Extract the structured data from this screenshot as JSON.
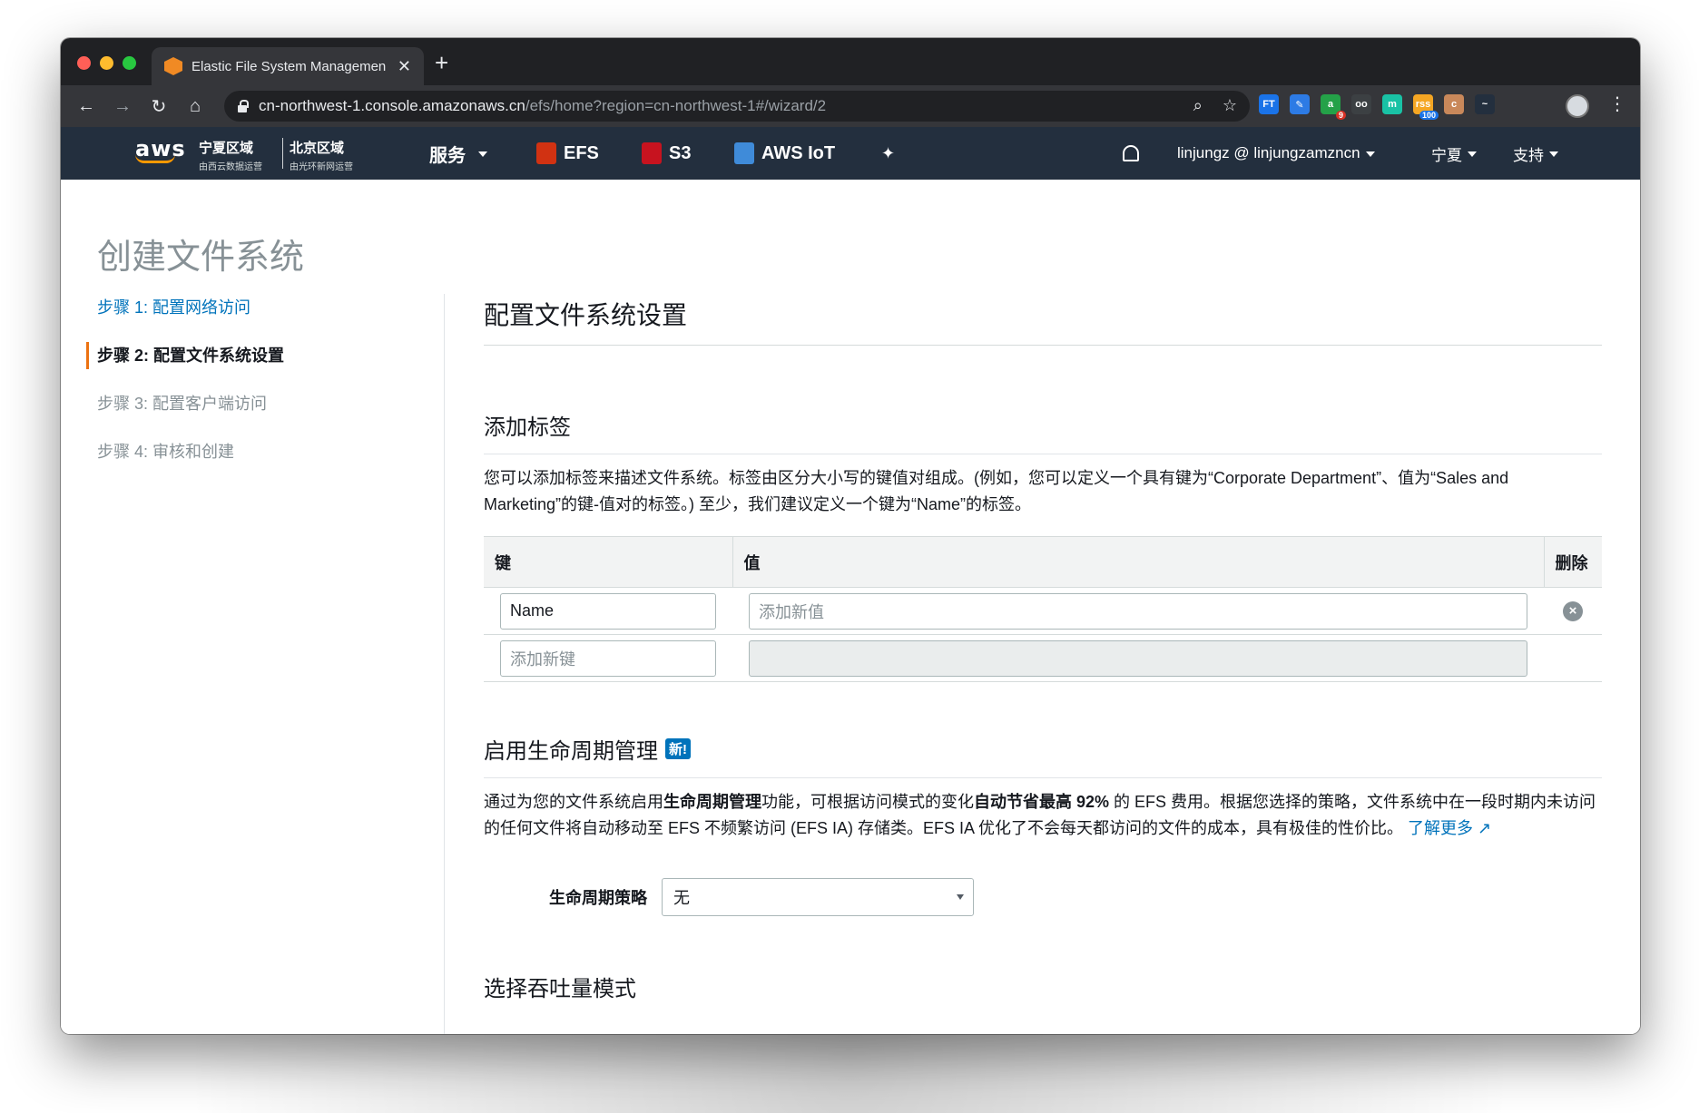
{
  "browser": {
    "tab_title": "Elastic File System Managemen",
    "new_tab": "+",
    "close_tab": "✕",
    "url_host": "cn-northwest-1.console.amazonaws.cn",
    "url_path": "/efs/home?region=cn-northwest-1#/wizard/2",
    "extensions": [
      {
        "name": "FT",
        "color": "#1a73e8"
      },
      {
        "name": "✎",
        "color": "#2d7be5"
      },
      {
        "name": "a",
        "color": "#24a148",
        "badge": "9"
      },
      {
        "name": "oo",
        "color": "#3c4043"
      },
      {
        "name": "m",
        "color": "#19c2a5"
      },
      {
        "name": "rss",
        "color": "#f5a623",
        "badge": "100"
      },
      {
        "name": "c",
        "color": "#c9885a"
      },
      {
        "name": "~",
        "color": "#232f3e"
      }
    ]
  },
  "aws": {
    "logo": "aws",
    "region1": {
      "name": "宁夏区域",
      "sub": "由西云数据运营"
    },
    "region2": {
      "name": "北京区域",
      "sub": "由光环新网运营"
    },
    "services_label": "服务",
    "shortcuts": [
      {
        "label": "EFS",
        "color": "#d13212"
      },
      {
        "label": "S3",
        "color": "#c7131f"
      },
      {
        "label": "AWS IoT",
        "color": "#3f8bd9"
      }
    ],
    "account": "linjungz @ linjungzamzncn",
    "region_menu": "宁夏",
    "support_menu": "支持"
  },
  "page": {
    "title": "创建文件系统",
    "steps": [
      {
        "label": "步骤 1: 配置网络访问",
        "state": "link"
      },
      {
        "label": "步骤 2: 配置文件系统设置",
        "state": "active"
      },
      {
        "label": "步骤 3: 配置客户端访问",
        "state": "disabled"
      },
      {
        "label": "步骤 4: 审核和创建",
        "state": "disabled"
      }
    ]
  },
  "main": {
    "heading": "配置文件系统设置",
    "tags": {
      "heading": "添加标签",
      "description": "您可以添加标签来描述文件系统。标签由区分大小写的键值对组成。(例如，您可以定义一个具有键为“Corporate Department”、值为“Sales and Marketing”的键-值对的标签。) 至少，我们建议定义一个键为“Name”的标签。",
      "col_key": "键",
      "col_value": "值",
      "col_delete": "删除",
      "row1_key": "Name",
      "row1_value_placeholder": "添加新值",
      "row2_key_placeholder": "添加新键"
    },
    "lifecycle": {
      "heading": "启用生命周期管理",
      "new_badge": "新!",
      "p1": "通过为您的文件系统启用",
      "b1": "生命周期管理",
      "p2": "功能，可根据访问模式的变化",
      "b2": "自动节省最高 92%",
      "p3": " 的 EFS 费用。根据您选择的策略，文件系统中在一段时期内未访问的任何文件将自动移动至 EFS 不频繁访问 (EFS IA) 存储类。EFS IA 优化了不会每天都访问的文件的成本，具有极佳的性价比。",
      "learn_more": "了解更多",
      "policy_label": "生命周期策略",
      "policy_value": "无"
    },
    "throughput_heading": "选择吞吐量模式"
  }
}
